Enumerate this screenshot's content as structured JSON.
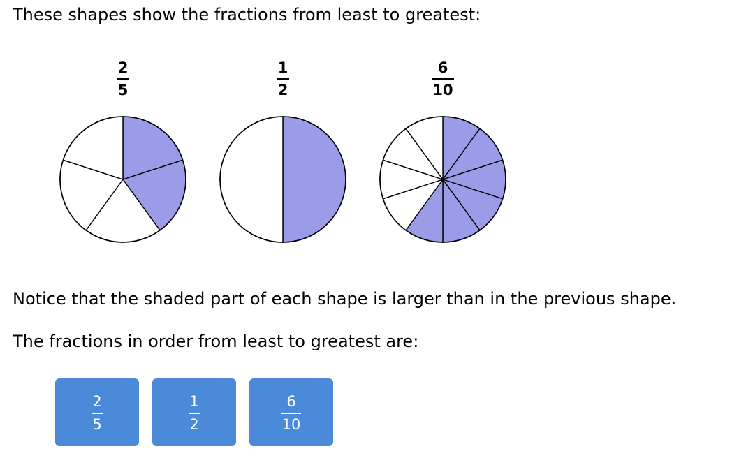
{
  "intro_text": "These shapes show the fractions from least to greatest:",
  "shapes": [
    {
      "numerator": "2",
      "denominator": "5",
      "parts": 5,
      "shaded": 2
    },
    {
      "numerator": "1",
      "denominator": "2",
      "parts": 2,
      "shaded": 1
    },
    {
      "numerator": "6",
      "denominator": "10",
      "parts": 10,
      "shaded": 6
    }
  ],
  "notice_text": "Notice that the shaded part of each shape is larger than in the previous shape.",
  "order_text": "The fractions in order from least to greatest are:",
  "answers": [
    {
      "numerator": "2",
      "denominator": "5"
    },
    {
      "numerator": "1",
      "denominator": "2"
    },
    {
      "numerator": "6",
      "denominator": "10"
    }
  ],
  "colors": {
    "shaded_fill": "#9b9ce8",
    "unshaded_fill": "#ffffff",
    "outline": "#000000",
    "button_bg": "#4a8ad9",
    "button_text": "#ffffff"
  }
}
